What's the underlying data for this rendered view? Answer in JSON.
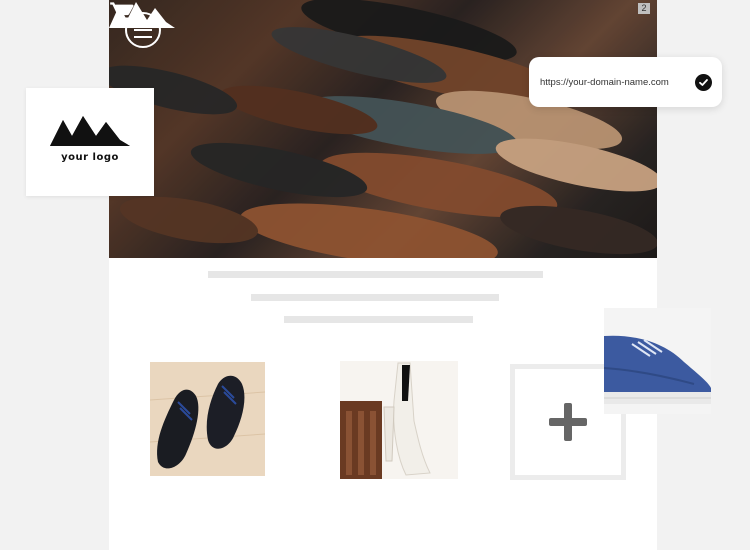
{
  "header": {
    "menu_icon": "hamburger-menu-icon",
    "logo_icon": "mountain-logo-icon",
    "cart_icon": "shopping-cart-icon",
    "cart_count": "2"
  },
  "logo_card": {
    "logo_icon": "mountain-logo-icon",
    "label": "your logo"
  },
  "domain": {
    "url": "https://your-domain-name.com",
    "status_icon": "check-circle-icon"
  },
  "products": {
    "items": [
      {
        "name": "black-dress-shoes"
      },
      {
        "name": "white-high-heels"
      }
    ],
    "add_icon": "plus-icon"
  },
  "colors": {
    "page_bg": "#f2f2f2",
    "card_bg": "#ffffff",
    "placeholder": "#e6e6e6",
    "add_border": "#ececec",
    "add_icon": "#666666"
  }
}
